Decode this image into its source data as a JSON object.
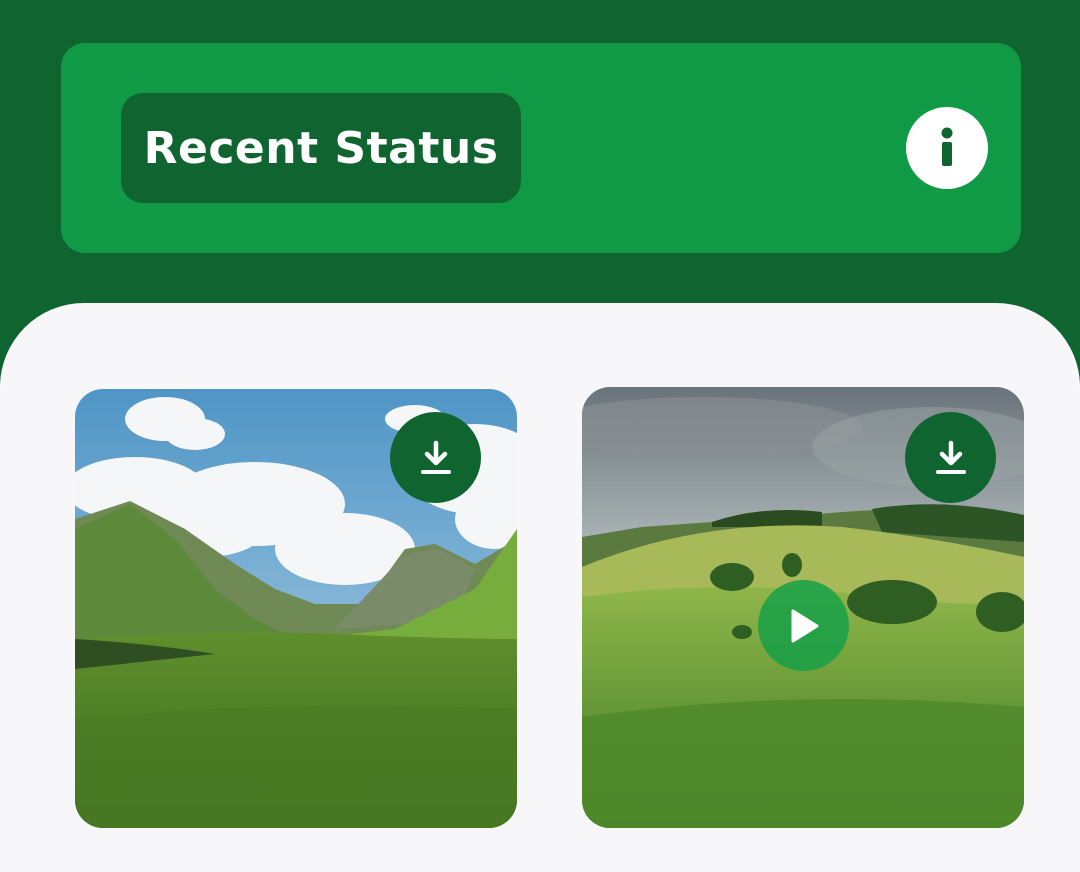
{
  "header": {
    "title": "Recent Status",
    "info_icon": "info-icon"
  },
  "colors": {
    "background": "#106430",
    "header_card": "#119a45",
    "title_pill": "#106430",
    "content_bg": "#f7f7f9",
    "accent_white": "#ffffff"
  },
  "statuses": [
    {
      "kind": "image",
      "icon": "download-icon"
    },
    {
      "kind": "video",
      "icon": "download-icon",
      "play_icon": "play-icon"
    }
  ]
}
